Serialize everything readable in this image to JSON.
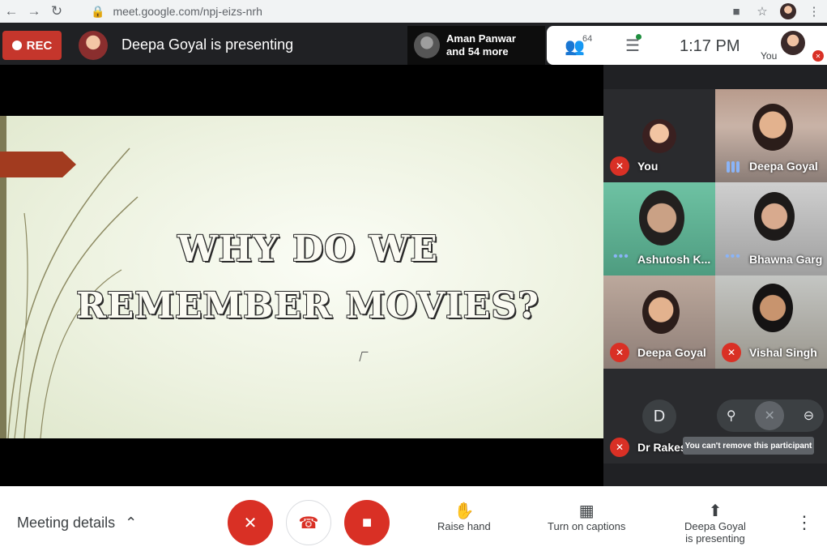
{
  "browser": {
    "url": "meet.google.com/npj-eizs-nrh",
    "icons": [
      "back-arrow-icon",
      "forward-arrow-icon",
      "reload-icon",
      "lock-icon",
      "camera-icon",
      "star-icon",
      "profile-avatar",
      "menu-dots-icon"
    ]
  },
  "topbar": {
    "rec_label": "REC",
    "presenting_text": "Deepa Goyal is presenting",
    "others_line1": "Aman Panwar",
    "others_line2": "and 54 more",
    "people_count": "64",
    "time": "1:17 PM",
    "you_label": "You"
  },
  "slide": {
    "line1": "WHY DO WE",
    "line2": "REMEMBER MOVIES?"
  },
  "tiles": [
    {
      "name": "You"
    },
    {
      "name": "Deepa Goyal"
    },
    {
      "name": "Ashutosh K..."
    },
    {
      "name": "Bhawna Garg"
    },
    {
      "name": "Deepa Goyal"
    },
    {
      "name": "Vishal Singh"
    },
    {
      "name": "Dr Rakes",
      "initial": "D",
      "tooltip": "You can't remove this participant"
    }
  ],
  "bottombar": {
    "meeting_details": "Meeting details",
    "raise_hand": "Raise hand",
    "captions": "Turn on captions",
    "present_line1": "Deepa Goyal",
    "present_line2": "is presenting"
  },
  "colors": {
    "red": "#d93025",
    "rec": "#c5362c",
    "dark": "#202124",
    "blue_accent": "#8ab4f8"
  }
}
